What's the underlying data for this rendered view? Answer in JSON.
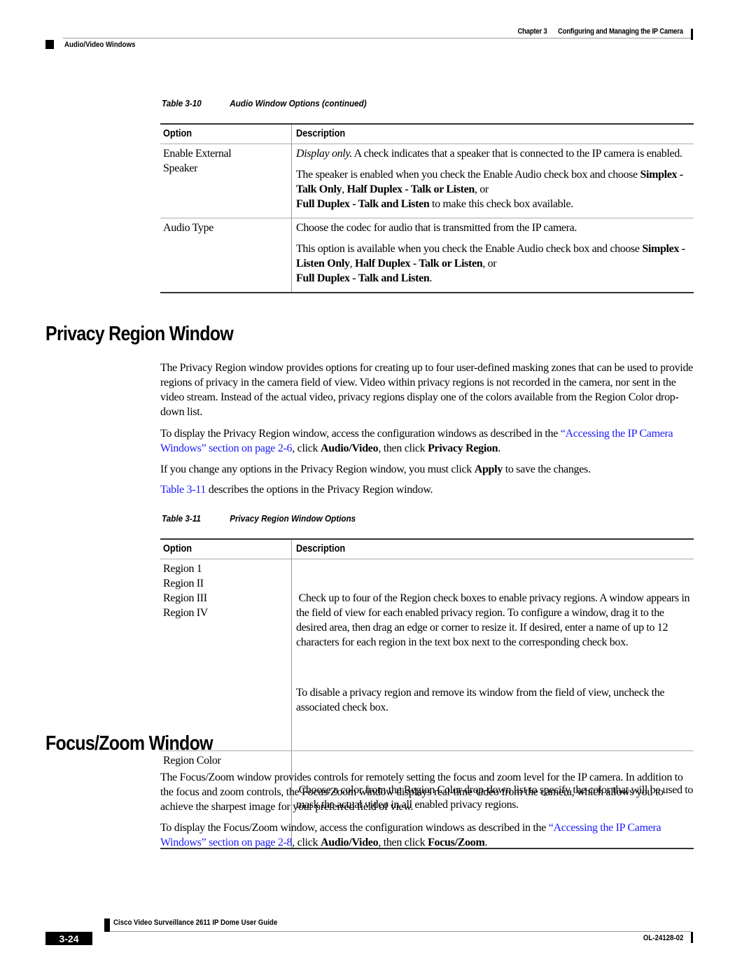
{
  "header": {
    "chapter": "Chapter 3",
    "chapter_title": "Configuring and Managing the IP Camera",
    "section": "Audio/Video Windows"
  },
  "table_3_10": {
    "number": "Table 3-10",
    "title": "Audio Window Options (continued)",
    "columns": [
      "Option",
      "Description"
    ],
    "rows": [
      {
        "option": "Enable External Speaker",
        "description": [
          {
            "italic_lead": "Display only.",
            "text": " A check indicates that a speaker that is connected to the IP camera is enabled."
          },
          {
            "pre": "The speaker is enabled when you check the Enable Audio check box and choose ",
            "b1": "Simplex - Talk Only",
            "mid1": ", ",
            "b2": "Half Duplex - Talk or Listen",
            "mid2": ", or ",
            "b3": "Full Duplex - Talk and Listen",
            "post": " to make this check box available."
          }
        ]
      },
      {
        "option": "Audio Type",
        "description": [
          {
            "text": "Choose the codec for audio that is transmitted from the IP camera."
          },
          {
            "pre": "This option is available when you check the Enable Audio check box and choose ",
            "b1": "Simplex - Listen Only",
            "mid1": ", ",
            "b2": "Half Duplex - Talk or Listen",
            "mid2": ", or ",
            "b3": "Full Duplex - Talk and Listen",
            "post": "."
          }
        ]
      }
    ]
  },
  "privacy_section": {
    "heading": "Privacy Region Window",
    "intro": "The Privacy Region window provides options for creating up to four user-defined masking zones that can be used to provide regions of privacy in the camera field of view. Video within privacy regions is not recorded in the camera, nor sent in the video stream. Instead of the actual video, privacy regions display one of the colors available from the Region Color drop-down list.",
    "access": {
      "pre": "To display the Privacy Region window, access the configuration windows as described in the ",
      "link": "“Accessing the IP Camera Windows” section on page 2-6",
      "mid1": ", click ",
      "b1": "Audio/Video",
      "mid2": ", then click ",
      "b2": "Privacy Region",
      "post": "."
    },
    "apply": {
      "pre": "If you change any options in the Privacy Region window, you must click ",
      "b1": "Apply",
      "post": " to save the changes."
    },
    "table_ref": {
      "link": "Table 3-11",
      "post": " describes the options in the Privacy Region window."
    }
  },
  "table_3_11": {
    "number": "Table 3-11",
    "title": "Privacy Region Window Options",
    "columns": [
      "Option",
      "Description"
    ],
    "rows": [
      {
        "options": [
          "Region 1",
          "Region II",
          "Region III",
          "Region IV"
        ],
        "description": [
          " Check up to four of the Region check boxes to enable privacy regions. A window appears in the field of view for each enabled privacy region. To configure a window, drag it to the desired area, then drag an edge or corner to resize it. If desired, enter a name of up to 12 characters for each region in the text box next to the corresponding check box.",
          "To disable a privacy region and remove its window from the field of view, uncheck the associated check box."
        ]
      },
      {
        "options": [
          "Region Color"
        ],
        "description": [
          " Choose a color from the Region Color drop-down list to specify the color that will be used to mask the actual video in all enabled privacy regions."
        ]
      }
    ]
  },
  "focus_section": {
    "heading": "Focus/Zoom Window",
    "intro": "The Focus/Zoom window provides controls for remotely setting the focus and zoom level for the IP camera. In addition to the focus and zoom controls, the Focus/Zoom window displays real-time video from the camera, which allows you to achieve the sharpest image for your preferred field of view.",
    "access": {
      "pre": "To display the Focus/Zoom window, access the configuration windows as described in the ",
      "link": "“Accessing the IP Camera Windows” section on page 2-8",
      "mid1": ", click ",
      "b1": "Audio/Video",
      "mid2": ", then click ",
      "b2": "Focus/Zoom",
      "post": "."
    }
  },
  "footer": {
    "guide_title": "Cisco Video Surveillance 2611 IP Dome User Guide",
    "page_number": "3-24",
    "doc_number": "OL-24128-02"
  },
  "colors": {
    "link": "#1a1aff",
    "text": "#000000",
    "rule": "#999999"
  }
}
